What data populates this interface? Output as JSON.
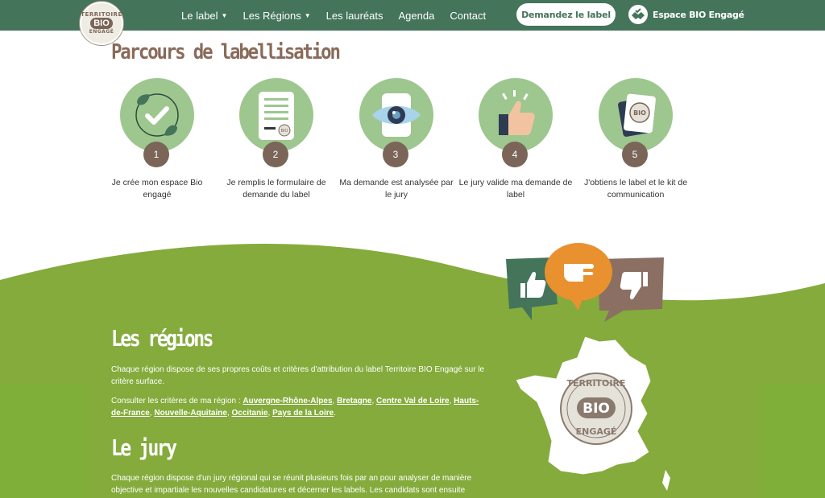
{
  "header": {
    "logo": {
      "top": "TERRITOIRE",
      "mid": "BIO",
      "bottom": "ENGAGÉ"
    },
    "nav": [
      {
        "label": "Le label",
        "dropdown": true
      },
      {
        "label": "Les Régions",
        "dropdown": true
      },
      {
        "label": "Les lauréats",
        "dropdown": false
      },
      {
        "label": "Agenda",
        "dropdown": false
      },
      {
        "label": "Contact",
        "dropdown": false
      }
    ],
    "cta_label": "Demandez le label",
    "space_label": "Espace BIO Engagé"
  },
  "parcours": {
    "title": "Parcours de labellisation",
    "steps": [
      {
        "number": "1",
        "icon": "check-leaves-icon",
        "text": "Je crée mon espace Bio engagé"
      },
      {
        "number": "2",
        "icon": "form-document-icon",
        "text": "Je remplis le formulaire de demande du label"
      },
      {
        "number": "3",
        "icon": "eye-icon",
        "text": "Ma demande est analysée par le jury"
      },
      {
        "number": "4",
        "icon": "thumbs-up-icon",
        "text": "Le jury valide ma demande de label"
      },
      {
        "number": "5",
        "icon": "label-kit-icon",
        "text": "J'obtiens le label et le kit de communication"
      }
    ]
  },
  "regions": {
    "title": "Les régions",
    "intro": "Chaque région dispose de ses propres coûts et critères d'attribution du label Territoire BIO Engagé sur le critère surface.",
    "criteria_prefix": "Consulter les critères de ma région : ",
    "links": [
      "Auvergne-Rhône-Alpes",
      "Bretagne",
      "Centre Val de Loire",
      "Hauts-de-France",
      "Nouvelle-Aquitaine",
      "Occitanie",
      "Pays de la Loire"
    ]
  },
  "jury": {
    "title": "Le jury",
    "text": "Chaque région dispose d'un jury régional qui se réunit plusieurs fois par an pour analyser de manière objective et impartiale les nouvelles candidatures et décerner les labels. Les candidats sont ensuite"
  },
  "colors": {
    "header": "#44745a",
    "accent_brown": "#7a6558",
    "step_green": "#9ec68f",
    "section_green": "#84ab3c",
    "bubble_orange": "#e8912e"
  }
}
